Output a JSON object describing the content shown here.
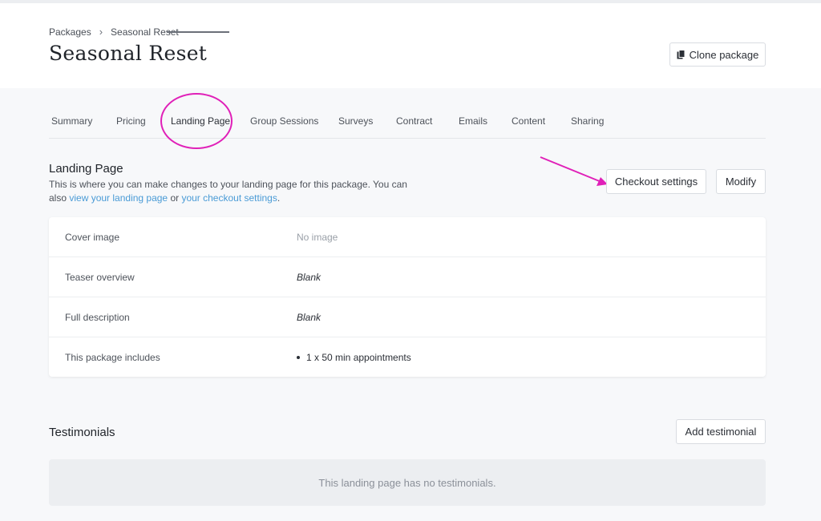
{
  "breadcrumb": {
    "parent": "Packages",
    "current": "Seasonal Reset"
  },
  "header": {
    "title": "Seasonal Reset",
    "clone_label": "Clone package"
  },
  "tabs": [
    {
      "label": "Summary"
    },
    {
      "label": "Pricing"
    },
    {
      "label": "Landing Page",
      "active": true
    },
    {
      "label": "Group Sessions"
    },
    {
      "label": "Surveys"
    },
    {
      "label": "Contract"
    },
    {
      "label": "Emails"
    },
    {
      "label": "Content"
    },
    {
      "label": "Sharing"
    }
  ],
  "landing": {
    "title": "Landing Page",
    "desc_pre": "This is where you can make changes to your landing page for this package. You can also ",
    "link1": "view your landing page",
    "desc_mid": " or ",
    "link2": "your checkout settings",
    "desc_end": ".",
    "checkout_label": "Checkout settings",
    "modify_label": "Modify",
    "rows": [
      {
        "label": "Cover image",
        "value": "No image"
      },
      {
        "label": "Teaser overview",
        "value": "Blank"
      },
      {
        "label": "Full description",
        "value": "Blank"
      },
      {
        "label": "This package includes",
        "value": "1 x 50 min appointments"
      }
    ]
  },
  "testimonials": {
    "title": "Testimonials",
    "add_label": "Add testimonial",
    "empty_text": "This landing page has no testimonials."
  },
  "colors": {
    "annotation": "#e020b8",
    "link": "#4a9bd6"
  }
}
